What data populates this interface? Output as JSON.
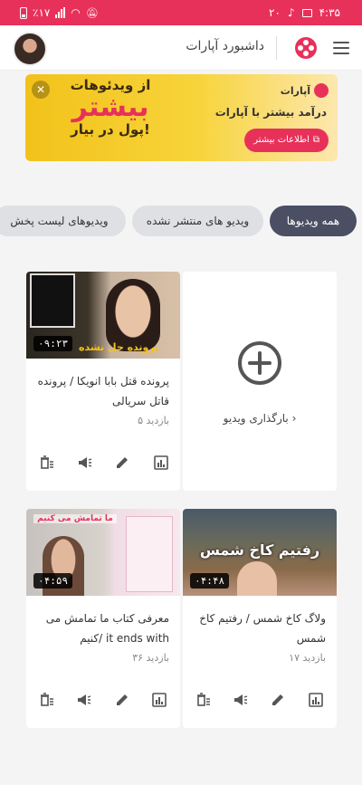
{
  "status_bar": {
    "battery": "٪۱۷",
    "notification_count": "۲۰",
    "time": "۴:۳۵"
  },
  "header": {
    "title": "داشبورد آپارات"
  },
  "banner": {
    "headline_top": "از ویدئوهات",
    "headline_big": "بیشتر",
    "headline_bottom": "پول در بیار!",
    "brand": "آپارات",
    "subtitle": "درآمد بیشتر با آپارات",
    "button_label": "اطلاعات بیشتر"
  },
  "filters": [
    "همه ویدیوها",
    "ویدیو های منتشر نشده",
    "ویدیوهای لیست پخش"
  ],
  "upload": {
    "label": "بارگذاری ویدیو ›"
  },
  "videos": [
    {
      "title": "پرونده قتل بابا انویکا / پرونده قاتل سریالی",
      "views": "۵ بازدید",
      "duration": "۰۹:۲۳",
      "thumb_text": "پرونده حل نشده"
    },
    {
      "title": "ولاگ کاخ شمس / رفتیم کاخ شمس",
      "views": "۱۷ بازدید",
      "duration": "۰۴:۴۸",
      "thumb_text": "رفتیم کاخ شمس"
    },
    {
      "title": "معرفی کتاب ما تمامش می کنیم/ it ends with",
      "views": "۳۶ بازدید",
      "duration": "۰۴:۵۹",
      "thumb_text": "ما تمامش می کنیم"
    }
  ],
  "colors": {
    "brand": "#e8315a",
    "chip_active": "#4a4f63",
    "chip": "#dfe0e4"
  }
}
